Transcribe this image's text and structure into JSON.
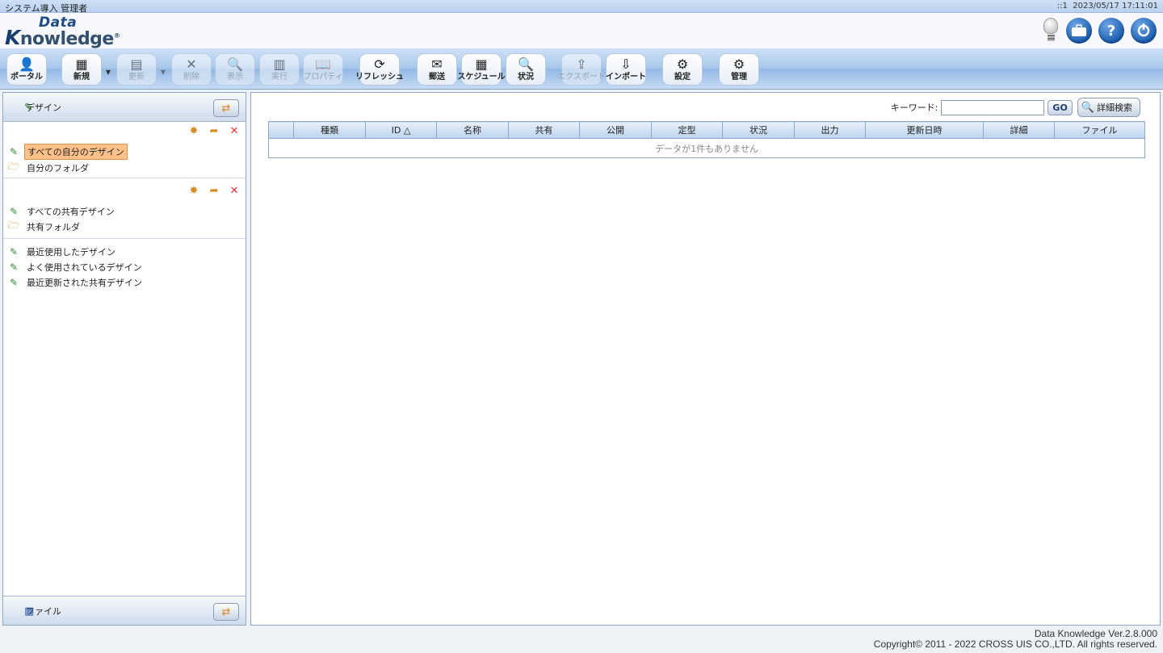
{
  "status": {
    "user": "システム導入 管理者",
    "session": "::1",
    "datetime": "2023/05/17 17:11:01"
  },
  "logo": {
    "line1": "Data",
    "line2_k": "K",
    "line2_rest": "nowledge",
    "mark": "®"
  },
  "header_icons": [
    "bulb-icon",
    "briefcase-icon",
    "help-icon",
    "logout-icon"
  ],
  "toolbar": [
    {
      "label": "ポータル",
      "icon": "portal-icon",
      "glyph": "👤",
      "enabled": true
    },
    {
      "label": "新規",
      "icon": "new-icon",
      "glyph": "▦",
      "enabled": true,
      "dropdown": true
    },
    {
      "label": "更新",
      "icon": "update-icon",
      "glyph": "▤",
      "enabled": false,
      "dropdown": true
    },
    {
      "label": "削除",
      "icon": "delete-icon",
      "glyph": "✕",
      "enabled": false
    },
    {
      "label": "表示",
      "icon": "view-icon",
      "glyph": "🔍",
      "enabled": false
    },
    {
      "label": "実行",
      "icon": "run-icon",
      "glyph": "▥",
      "enabled": false
    },
    {
      "label": "プロパティ",
      "icon": "properties-icon",
      "glyph": "📖",
      "enabled": false
    },
    {
      "label": "リフレッシュ",
      "icon": "refresh-icon",
      "glyph": "⟳",
      "enabled": true
    },
    {
      "label": "郵送",
      "icon": "mail-icon",
      "glyph": "✉",
      "enabled": true
    },
    {
      "label": "スケジュール",
      "icon": "schedule-icon",
      "glyph": "▦",
      "enabled": true
    },
    {
      "label": "状況",
      "icon": "status-icon",
      "glyph": "🔍",
      "enabled": true
    },
    {
      "label": "エクスポート",
      "icon": "export-icon",
      "glyph": "⇪",
      "enabled": false
    },
    {
      "label": "インポート",
      "icon": "import-icon",
      "glyph": "⇩",
      "enabled": true
    },
    {
      "label": "設定",
      "icon": "settings-icon",
      "glyph": "⚙",
      "enabled": true
    },
    {
      "label": "管理",
      "icon": "admin-icon",
      "glyph": "⚙",
      "enabled": true
    }
  ],
  "left_panel": {
    "title": "デザイン",
    "footer_title": "ファイル",
    "my_section": {
      "items": [
        {
          "label": "すべての自分のデザイン",
          "icon": "pencil-icon",
          "selected": true
        },
        {
          "label": "自分のフォルダ",
          "icon": "folder-icon",
          "selected": false
        }
      ]
    },
    "shared_section": {
      "items": [
        {
          "label": "すべての共有デザイン",
          "icon": "pencil-icon"
        },
        {
          "label": "共有フォルダ",
          "icon": "shared-folder-icon"
        }
      ]
    },
    "recent_section": {
      "items": [
        {
          "label": "最近使用したデザイン",
          "icon": "pencil-icon"
        },
        {
          "label": "よく使用されているデザイン",
          "icon": "pencil-icon"
        },
        {
          "label": "最近更新された共有デザイン",
          "icon": "pencil-icon"
        }
      ]
    }
  },
  "search": {
    "label": "キーワード:",
    "value": "",
    "go_label": "GO",
    "advanced_label": "詳細検索"
  },
  "grid": {
    "columns": [
      "",
      "種類",
      "ID △",
      "名称",
      "共有",
      "公開",
      "定型",
      "状況",
      "出力",
      "更新日時",
      "詳細",
      "ファイル"
    ],
    "empty_message": "データが1件もありません"
  },
  "footer": {
    "version": "Data Knowledge Ver.2.8.000",
    "copyright": "Copyright© 2011 - 2022 CROSS UIS CO.,LTD. All rights reserved."
  }
}
